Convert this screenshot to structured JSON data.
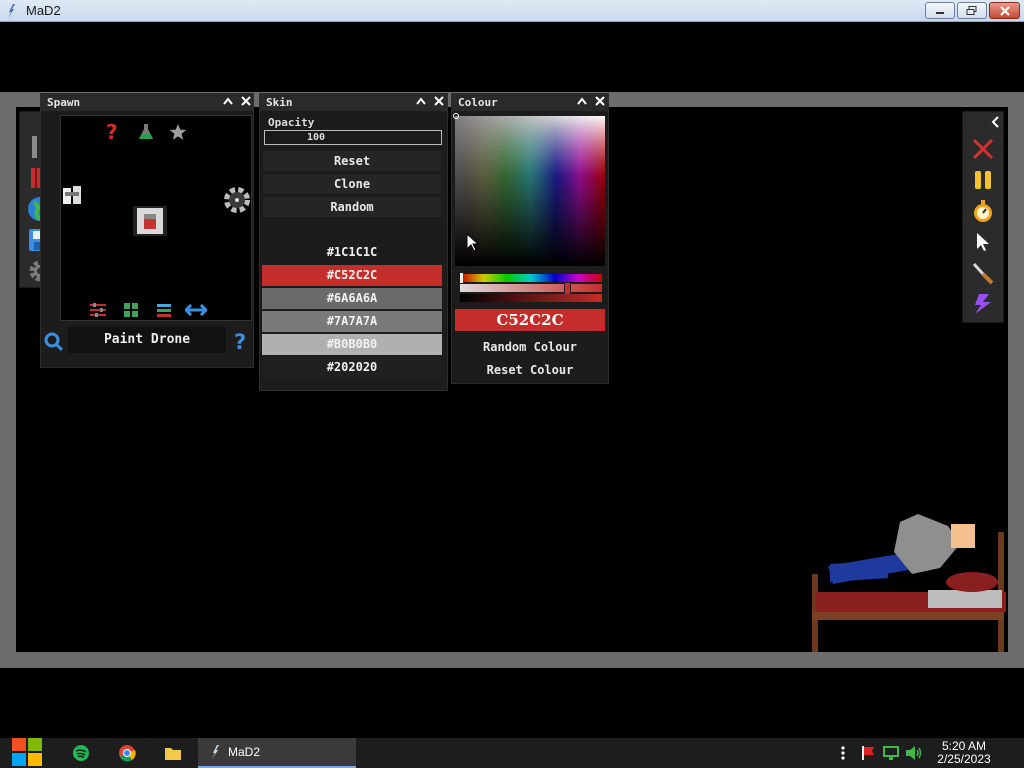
{
  "window": {
    "title": "MaD2"
  },
  "spawn_panel": {
    "title": "Spawn",
    "category_icons": [
      "question-icon",
      "flask-icon",
      "star-icon"
    ],
    "items": [
      "ragdoll-item",
      "drone-item",
      "gear-item"
    ],
    "bottom_icons": [
      "sliders-icon",
      "grid-icon",
      "list-icon",
      "swap-arrows-icon"
    ],
    "selected_name": "Paint Drone"
  },
  "skin_panel": {
    "title": "Skin",
    "opacity_label": "Opacity",
    "opacity_value": "100",
    "buttons": [
      "Reset",
      "Clone",
      "Random"
    ],
    "swatches": [
      {
        "label": "#1C1C1C",
        "color": "#1c1c1c"
      },
      {
        "label": "#C52C2C",
        "color": "#c52c2c"
      },
      {
        "label": "#6A6A6A",
        "color": "#6a6a6a"
      },
      {
        "label": "#7A7A7A",
        "color": "#7a7a7a"
      },
      {
        "label": "#B0B0B0",
        "color": "#b0b0b0"
      },
      {
        "label": "#202020",
        "color": "#202020"
      }
    ]
  },
  "colour_panel": {
    "title": "Colour",
    "hex_value": "C52C2C",
    "random_label": "Random Colour",
    "reset_label": "Reset Colour",
    "accent": "#c52c2c"
  },
  "right_toolbar": {
    "tools": [
      "close-x-icon",
      "pause-icon",
      "stopwatch-icon",
      "pointer-icon",
      "knife-icon",
      "lightning-icon"
    ]
  },
  "taskbar": {
    "app_label": "MaD2",
    "time": "5:20 AM",
    "date": "2/25/2023"
  }
}
